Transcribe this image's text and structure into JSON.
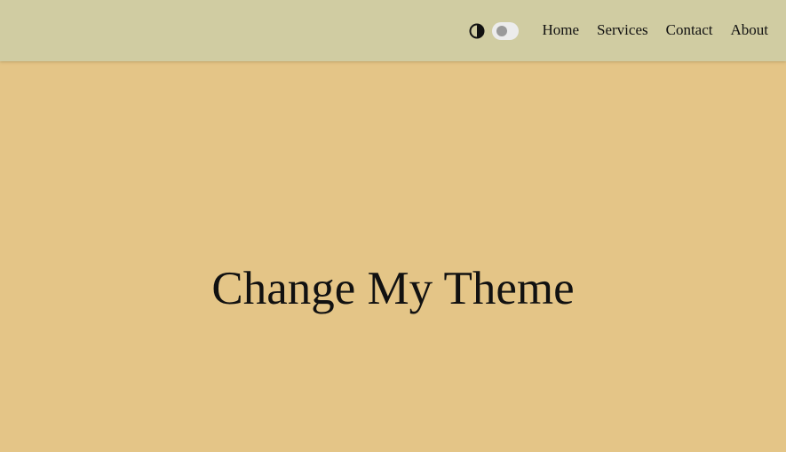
{
  "header": {
    "theme_toggle": {
      "icon": "contrast-icon",
      "state": "off"
    },
    "nav": [
      {
        "label": "Home"
      },
      {
        "label": "Services"
      },
      {
        "label": "Contact"
      },
      {
        "label": "About"
      }
    ]
  },
  "hero": {
    "title": "Change My Theme"
  },
  "colors": {
    "page_background": "#e4c587",
    "header_background": "#d0cca2",
    "text": "#111111",
    "switch_track": "#ececec",
    "switch_knob": "#9a9a9a"
  }
}
